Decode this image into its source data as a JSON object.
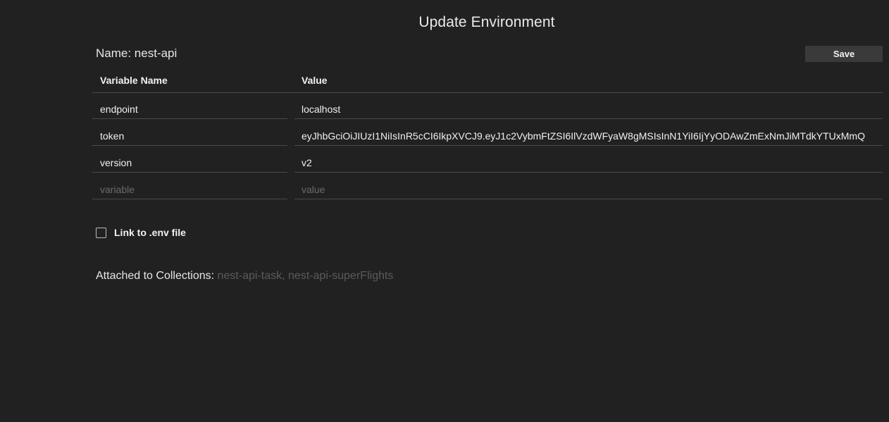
{
  "header": {
    "title": "Update Environment"
  },
  "environment": {
    "name_label": "Name: nest-api",
    "save_label": "Save"
  },
  "table": {
    "columns": [
      "Variable Name",
      "Value"
    ],
    "rows": [
      {
        "variable": "endpoint",
        "value": "localhost"
      },
      {
        "variable": "token",
        "value": "eyJhbGciOiJIUzI1NiIsInR5cCI6IkpXVCJ9.eyJ1c2VybmFtZSI6IlVzdWFyaW8gMSIsInN1YiI6IjYyODAwZmExNmJiMTdkYTUxMmQ"
      },
      {
        "variable": "version",
        "value": "v2"
      }
    ],
    "new_row": {
      "variable_placeholder": "variable",
      "value_placeholder": "value"
    }
  },
  "link_env": {
    "label": "Link to .env file",
    "checked": false
  },
  "attached": {
    "label": "Attached to Collections:",
    "collections": "nest-api-task, nest-api-superFlights"
  },
  "colors": {
    "background": "#212121",
    "button": "#3a3a3a",
    "divider": "#4a4a4a",
    "muted_text": "#5b5b5b"
  }
}
